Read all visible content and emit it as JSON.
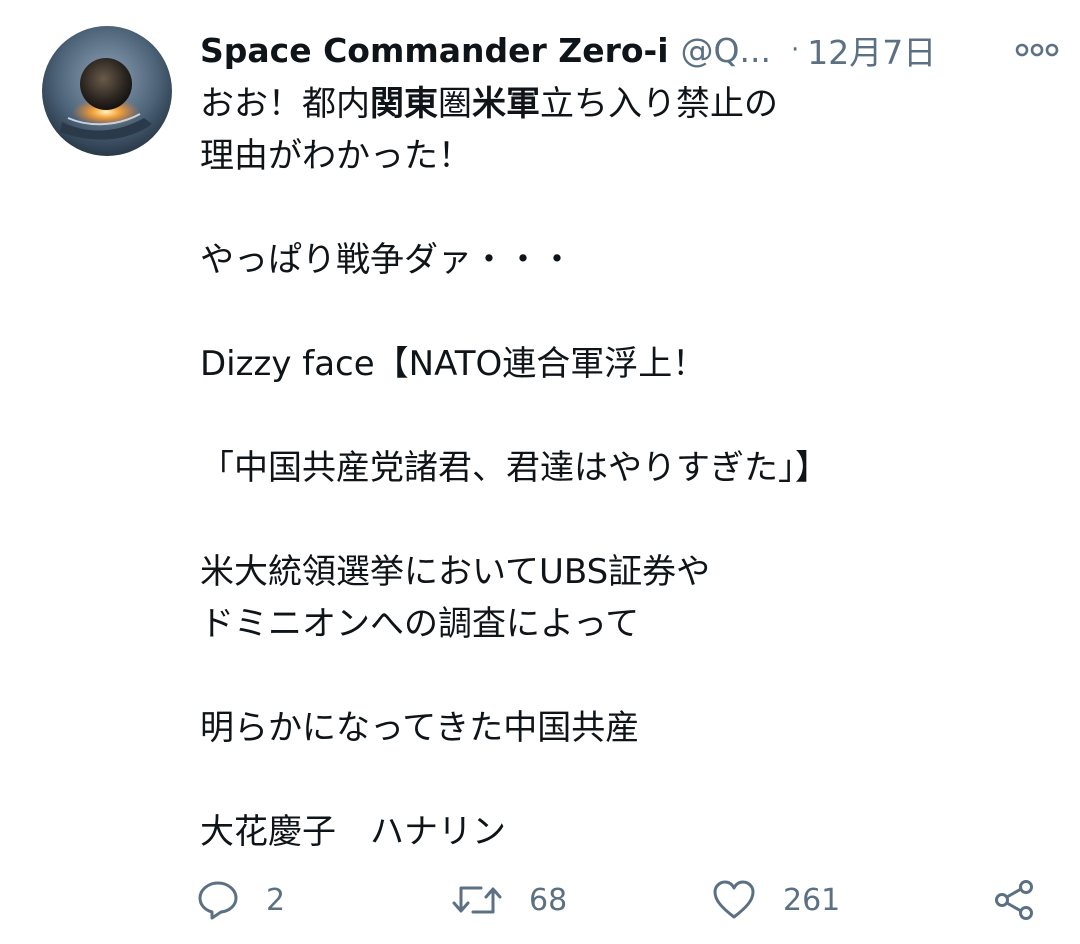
{
  "tweet": {
    "author_name": "Space Commander Zero-i",
    "handle": "@Q...",
    "separator": "·",
    "date": "12月7日",
    "body": {
      "l1": {
        "a": "おお！都内",
        "b": "関東",
        "c": "圏",
        "d": "米軍",
        "e": "立ち入り禁止の"
      },
      "l2": "理由がわかった！",
      "l3": "やっぱり戦争ダァ・・・",
      "l4": "Dizzy face【NATO連合軍浮上！",
      "l5": "「中国共産党諸君、君達はやりすぎた」】",
      "l6": "米大統領選挙においてUBS証券や",
      "l7": "ドミニオンへの調査によって",
      "l8": "明らかになってきた中国共産",
      "l9": "大花慶子　ハナリン"
    },
    "actions": {
      "reply_count": "2",
      "retweet_count": "68",
      "like_count": "261"
    }
  },
  "icons": {
    "avatar": "avatar-earth-in-hand",
    "more": "more-dots-icon",
    "reply": "reply-icon",
    "retweet": "retweet-icon",
    "like": "heart-icon",
    "share": "share-icon"
  },
  "colors": {
    "text": "#0f1419",
    "secondary": "#5b7083"
  }
}
